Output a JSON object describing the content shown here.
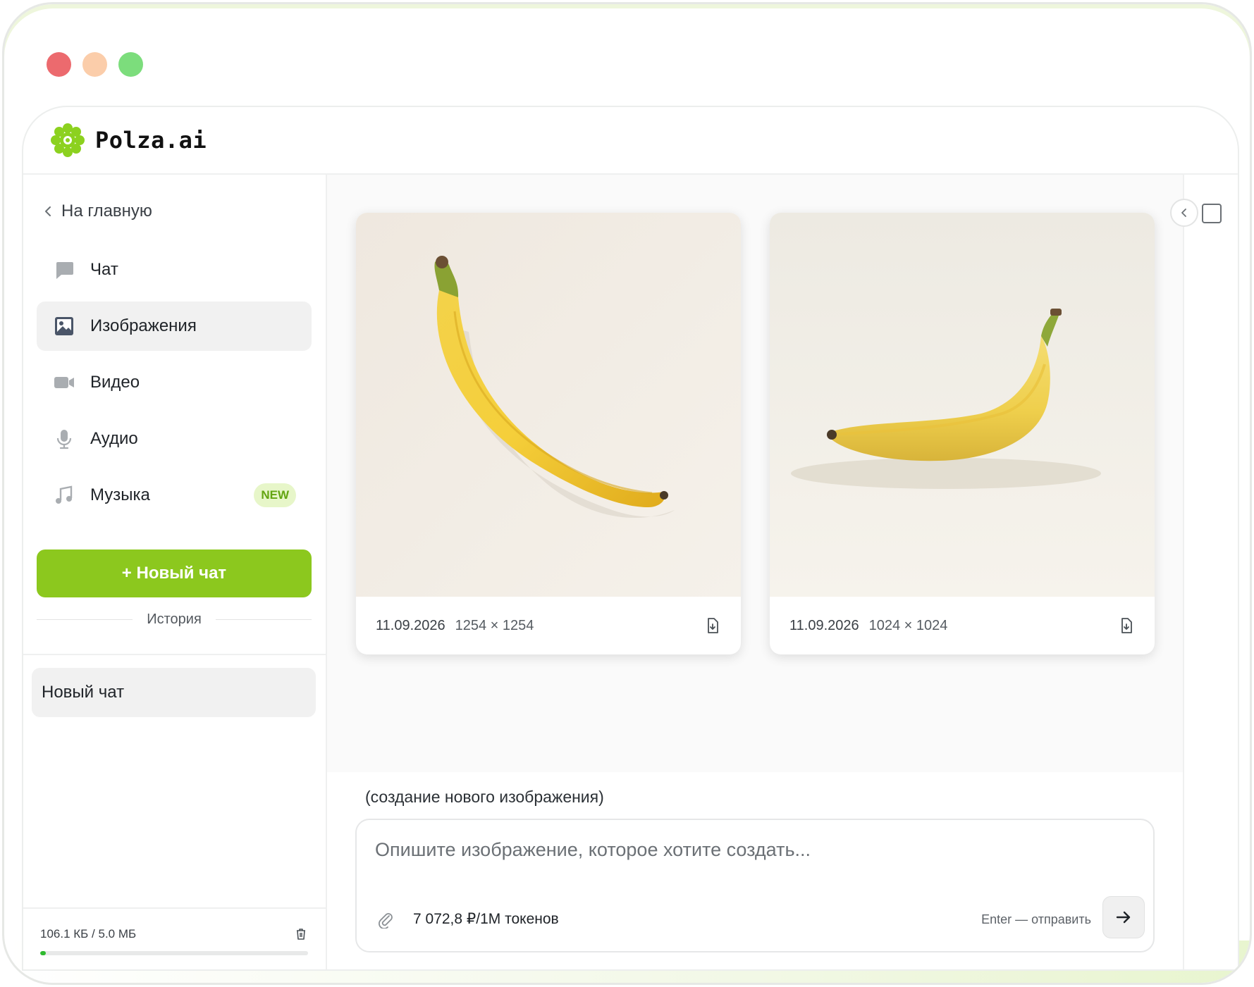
{
  "window_controls": {
    "close_color": "#ec6a6e",
    "minimize_color": "#fbcdaa",
    "maximize_color": "#7cdd7c"
  },
  "header": {
    "brand": "Polza.ai",
    "logo_icon": "flower-logo-icon",
    "accent": "#8cc81e"
  },
  "sidebar": {
    "back_label": "На главную",
    "items": [
      {
        "label": "Чат",
        "icon": "chat-bubble-icon",
        "active": false
      },
      {
        "label": "Изображения",
        "icon": "image-icon",
        "active": true
      },
      {
        "label": "Видео",
        "icon": "video-camera-icon",
        "active": false
      },
      {
        "label": "Аудио",
        "icon": "microphone-icon",
        "active": false
      },
      {
        "label": "Музыка",
        "icon": "music-note-icon",
        "active": false,
        "badge": "NEW"
      }
    ],
    "new_chat_label": "+ Новый чат",
    "history_label": "История",
    "history_items": [
      {
        "label": "Новый чат"
      }
    ],
    "storage": {
      "label": "106.1 КБ / 5.0 МБ",
      "fraction": 0.021
    }
  },
  "gallery": [
    {
      "date": "11.09.2026",
      "size": "1254 × 1254",
      "icon": "download-file-icon"
    },
    {
      "date": "11.09.2026",
      "size": "1024 × 1024",
      "icon": "download-file-icon"
    }
  ],
  "composer": {
    "mode_label": "(создание нового изображения)",
    "placeholder": "Опишите изображение, которое хотите создать...",
    "price": "7 072,8 ₽/1M токенов",
    "hint": "Enter — отправить"
  }
}
